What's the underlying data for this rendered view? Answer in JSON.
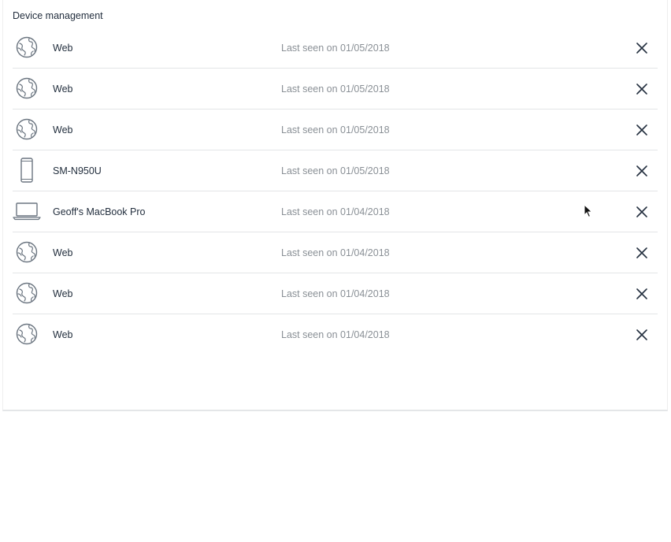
{
  "page": {
    "title": "Device management"
  },
  "devices": [
    {
      "name": "Web",
      "last_seen": "Last seen on 01/05/2018",
      "icon": "globe-icon"
    },
    {
      "name": "Web",
      "last_seen": "Last seen on 01/05/2018",
      "icon": "globe-icon"
    },
    {
      "name": "Web",
      "last_seen": "Last seen on 01/05/2018",
      "icon": "globe-icon"
    },
    {
      "name": "SM-N950U",
      "last_seen": "Last seen on 01/05/2018",
      "icon": "phone-icon"
    },
    {
      "name": "Geoff's MacBook Pro",
      "last_seen": "Last seen on 01/04/2018",
      "icon": "laptop-icon"
    },
    {
      "name": "Web",
      "last_seen": "Last seen on 01/04/2018",
      "icon": "globe-icon"
    },
    {
      "name": "Web",
      "last_seen": "Last seen on 01/04/2018",
      "icon": "globe-icon"
    },
    {
      "name": "Web",
      "last_seen": "Last seen on 01/04/2018",
      "icon": "globe-icon"
    }
  ],
  "icons": {
    "remove": "close-icon",
    "cursor": "mouse-pointer-icon"
  },
  "colors": {
    "text": "#232f3e",
    "muted": "#8a9096",
    "divider": "#e3e5e7"
  }
}
